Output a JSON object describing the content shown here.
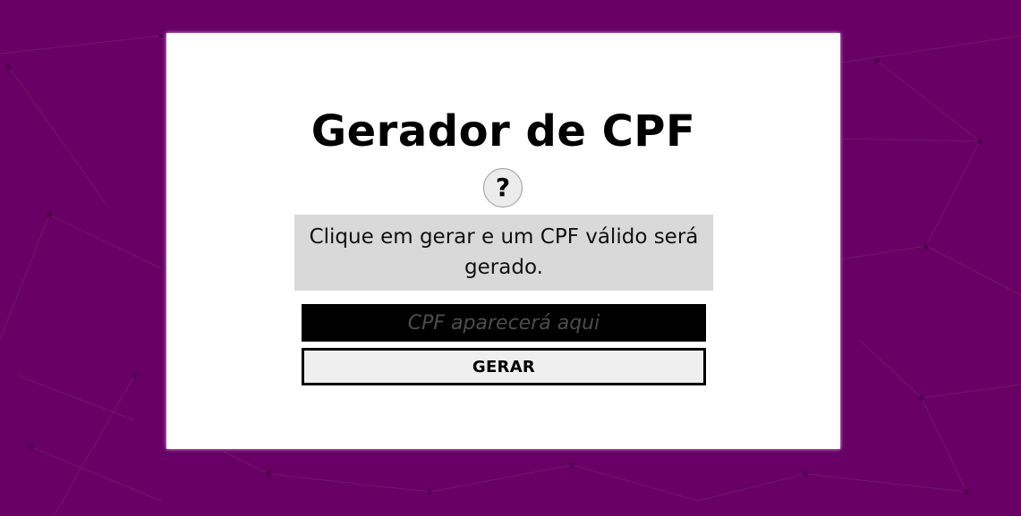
{
  "colors": {
    "background": "#680066",
    "card": "#ffffff",
    "info_box": "#d9d9d9",
    "output_field": "#000000",
    "button": "#efefef"
  },
  "header": {
    "title": "Gerador de CPF"
  },
  "help": {
    "icon": "question-mark-icon",
    "label": "?"
  },
  "info": {
    "text": "Clique em gerar e um CPF válido será gerado."
  },
  "output": {
    "value": "",
    "placeholder": "CPF aparecerá aqui"
  },
  "actions": {
    "generate_label": "GERAR"
  }
}
